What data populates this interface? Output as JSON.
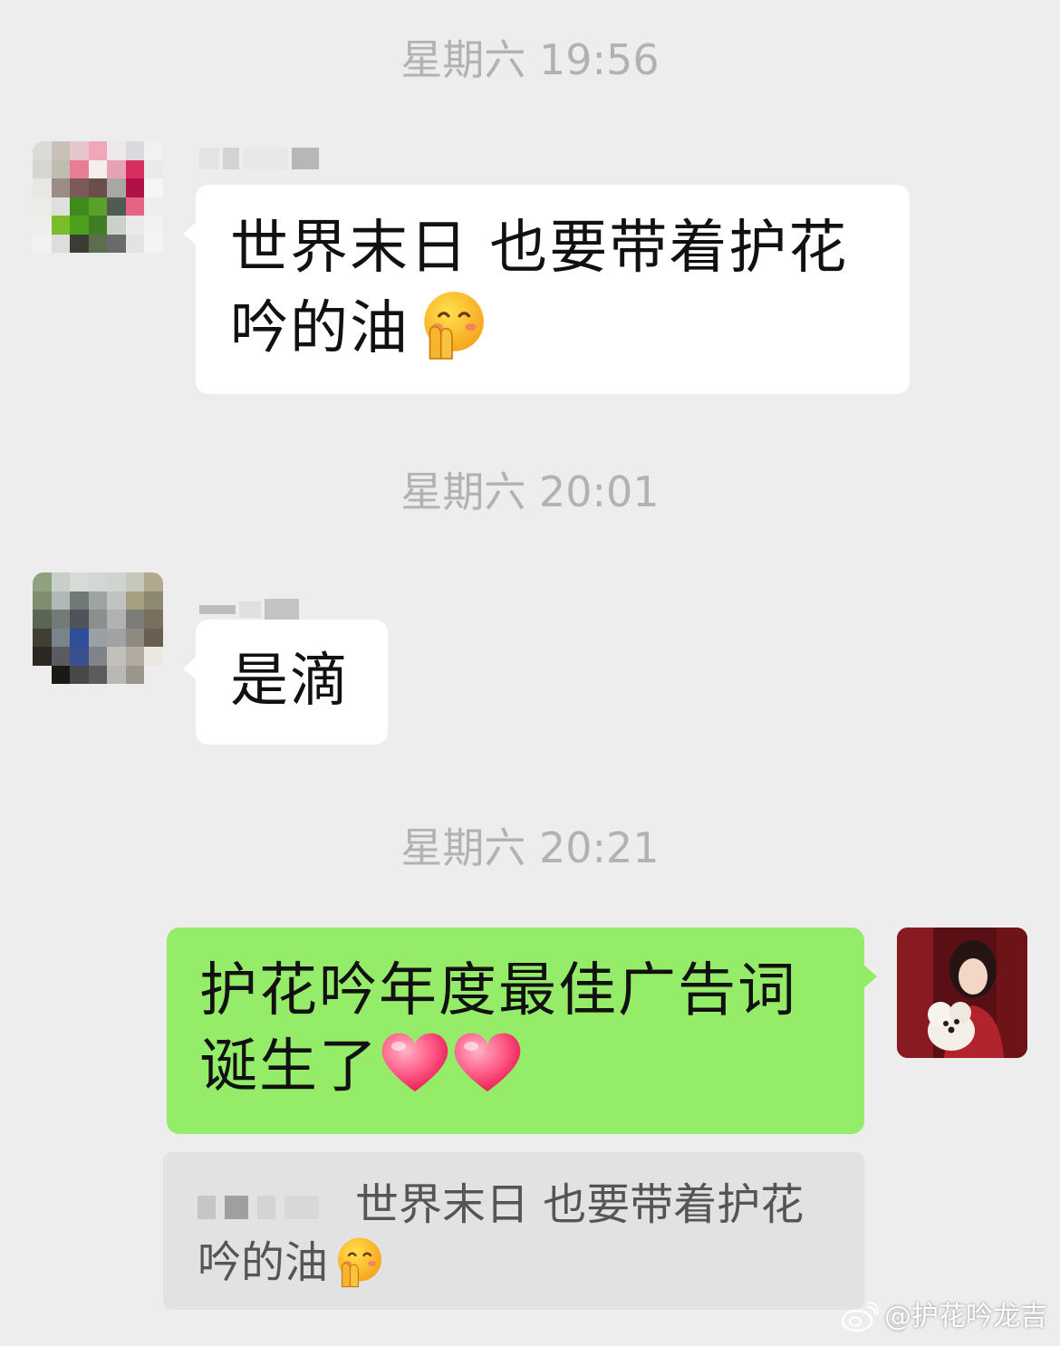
{
  "messages": [
    {
      "timestamp": "星期六 19:56",
      "direction": "incoming",
      "text": "世界末日 也要带着护花吟的油",
      "emoji": "shushing-face"
    },
    {
      "timestamp": "星期六 20:01",
      "direction": "incoming",
      "text": "是滴"
    },
    {
      "timestamp": "星期六 20:21",
      "direction": "outgoing",
      "text": "护花吟年度最佳广告词诞生了",
      "emoji": "heart x2",
      "quote": {
        "text": "世界末日 也要带着护花吟的油",
        "emoji": "shushing-face"
      }
    }
  ],
  "watermark": "@护花吟龙吉",
  "colors": {
    "background": "#ededed",
    "incoming_bubble": "#ffffff",
    "outgoing_bubble": "#95ec69",
    "timestamp_text": "#b2b2b2",
    "quote_bg": "#e2e2e2"
  }
}
